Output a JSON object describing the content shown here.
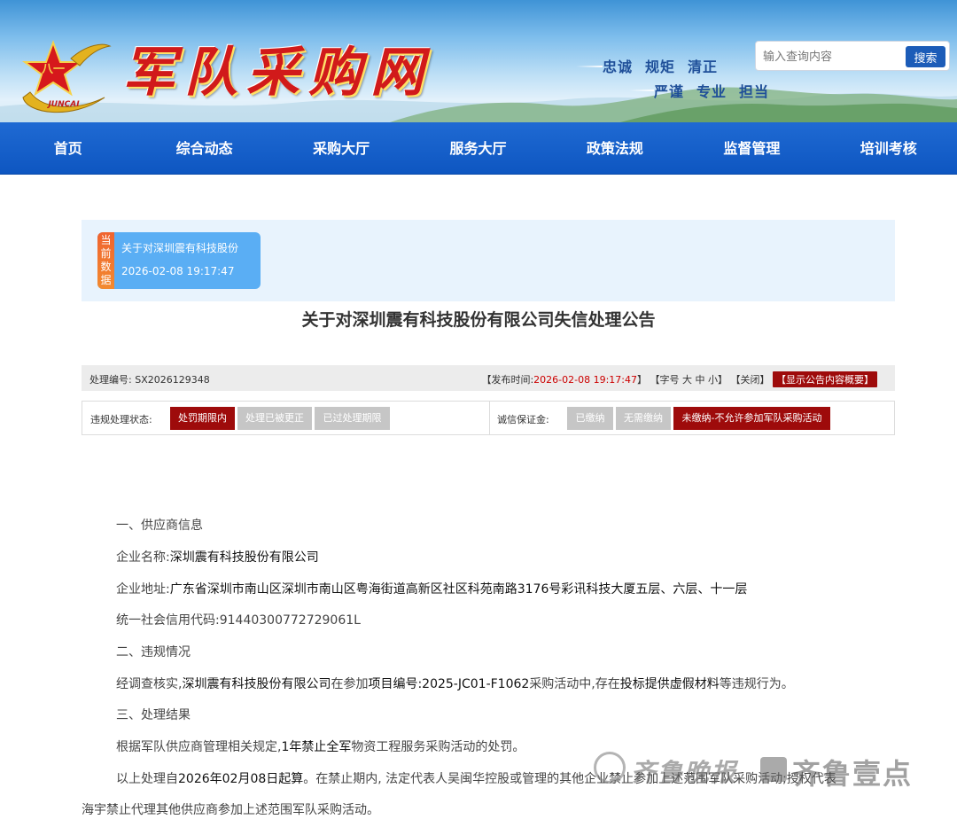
{
  "header": {
    "site_name": "军队采购网",
    "logo_text": "JUNCAI",
    "motto_row1": [
      "忠诚",
      "规矩",
      "清正"
    ],
    "motto_row2": [
      "严谨",
      "专业",
      "担当"
    ],
    "search": {
      "placeholder": "输入查询内容",
      "button": "搜索"
    }
  },
  "nav": [
    "首页",
    "综合动态",
    "采购大厅",
    "服务大厅",
    "政策法规",
    "监督管理",
    "培训考核"
  ],
  "current": {
    "tag": "当前数据",
    "title": "关于对深圳震有科技股份",
    "time": "2026-02-08 19:17:47"
  },
  "article": {
    "title": "关于对深圳震有科技股份有限公司失信处理公告",
    "info": {
      "number_label": "处理编号:",
      "number": "SX2026129348",
      "publish_label": "【发布时间:",
      "publish_time": "2026-02-08 19:17:47",
      "publish_end": "】",
      "font_prefix": "【字号",
      "font_large": "大",
      "font_medium": "中",
      "font_small": "小",
      "font_suffix": "】",
      "close": "【关闭】",
      "summary": "【显示公告内容概要】"
    },
    "status": {
      "violation_label": "违规处理状态:",
      "violation_options": [
        "处罚期限内",
        "处理已被更正",
        "已过处理期限"
      ],
      "deposit_label": "诚信保证金:",
      "deposit_options": [
        "已缴纳",
        "无需缴纳",
        "未缴纳-不允许参加军队采购活动"
      ]
    },
    "body": {
      "s1": "一、供应商信息",
      "name_label": "企业名称:",
      "name": "深圳震有科技股份有限公司",
      "addr_label": "企业地址:",
      "addr": "广东省深圳市南山区深圳市南山区粤海街道高新区社区科苑南路3176号彩讯科技大厦五层、六层、十一层",
      "code_label": "统一社会信用代码:",
      "code": "91440300772729061L",
      "s2": "二、违规情况",
      "v_prefix": "经调查核实,",
      "v_company": "深圳震有科技股份有限公司",
      "v_mid": "在参加",
      "v_project": "项目编号:2025-JC01-F1062",
      "v_mid2": "采购活动中,存在",
      "v_behavior": "投标提供虚假材料",
      "v_suffix": "等违规行为。",
      "s3": "三、处理结果",
      "r1_prefix": "根据军队供应商管理相关规定,",
      "r1_penalty": "1年禁止全军",
      "r1_suffix": "物资工程服务采购活动的处罚。",
      "r2_prefix": "以上处理自",
      "r2_date": "2026年02月08日起算",
      "r2_suffix": "。在禁止期内, 法定代表人吴闽华控股或管理的其他企业禁止参加上述范围军队采购活动;授权代表",
      "r3": "海宇禁止代理其他供应商参加上述范围军队采购活动。"
    }
  },
  "watermark": {
    "left": "齐鲁晚报",
    "right": "齐鲁壹点"
  },
  "colors": {
    "nav": "#0e56c1",
    "accent_red": "#9e0b0b",
    "card": "#5aaef4",
    "tag": "#f0632f"
  }
}
